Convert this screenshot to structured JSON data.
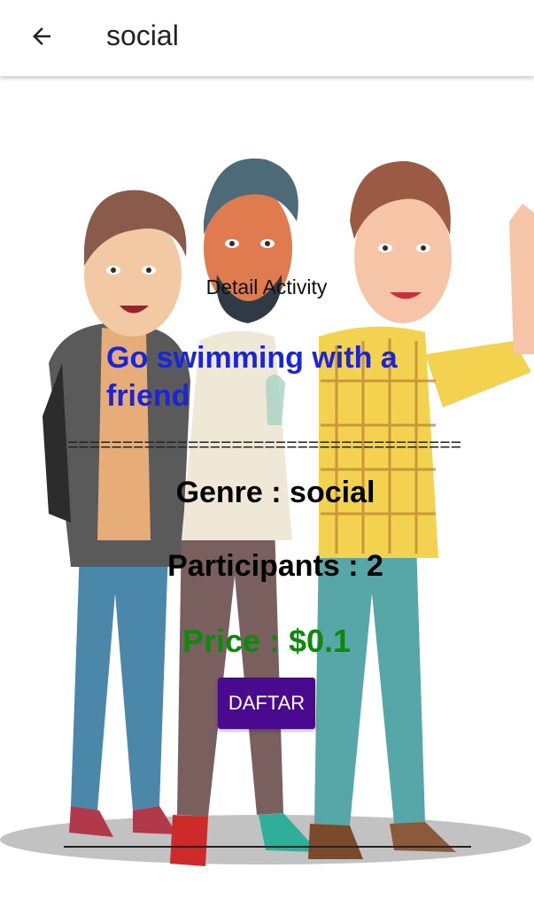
{
  "appbar": {
    "title": "social",
    "back_icon": "arrow-left-icon"
  },
  "detail": {
    "heading": "Detail Activity",
    "activity": "Go swimming with a friend",
    "divider": "====================================",
    "genre": "Genre : social",
    "participants": "Participants : 2",
    "price": "Price : $0.1",
    "button_label": "DAFTAR"
  },
  "colors": {
    "activity_text": "#1a24dc",
    "price_text": "#0d8a0d",
    "button_bg": "#4a0a90"
  }
}
